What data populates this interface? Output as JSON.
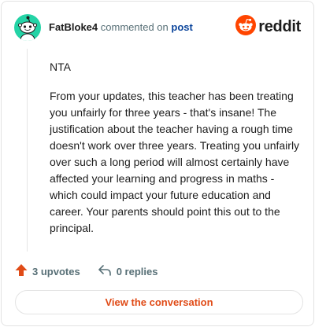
{
  "comment": {
    "author": "FatBloke4",
    "action_text": "commented on",
    "post_link": "post",
    "paragraphs": [
      "NTA",
      "From your updates, this teacher has been treating you unfairly for three years - that's insane! The justification about the teacher having a rough time doesn't work over three years. Treating you unfairly over such a long period will almost certainly have affected your learning and progress in maths - which could impact your future education and career. Your parents should point this out to the principal."
    ]
  },
  "brand": {
    "name": "reddit",
    "color": "#ff4500"
  },
  "actions": {
    "upvotes": "3 upvotes",
    "replies": "0 replies"
  },
  "view_button": "View the conversation",
  "colors": {
    "accent": "#e04b17",
    "avatar": "#24d3a6",
    "link": "#0a449b",
    "muted": "#576f76"
  },
  "icons": [
    "snoo-avatar-icon",
    "reddit-logo-icon",
    "upvote-arrow-icon",
    "reply-arrow-icon"
  ]
}
